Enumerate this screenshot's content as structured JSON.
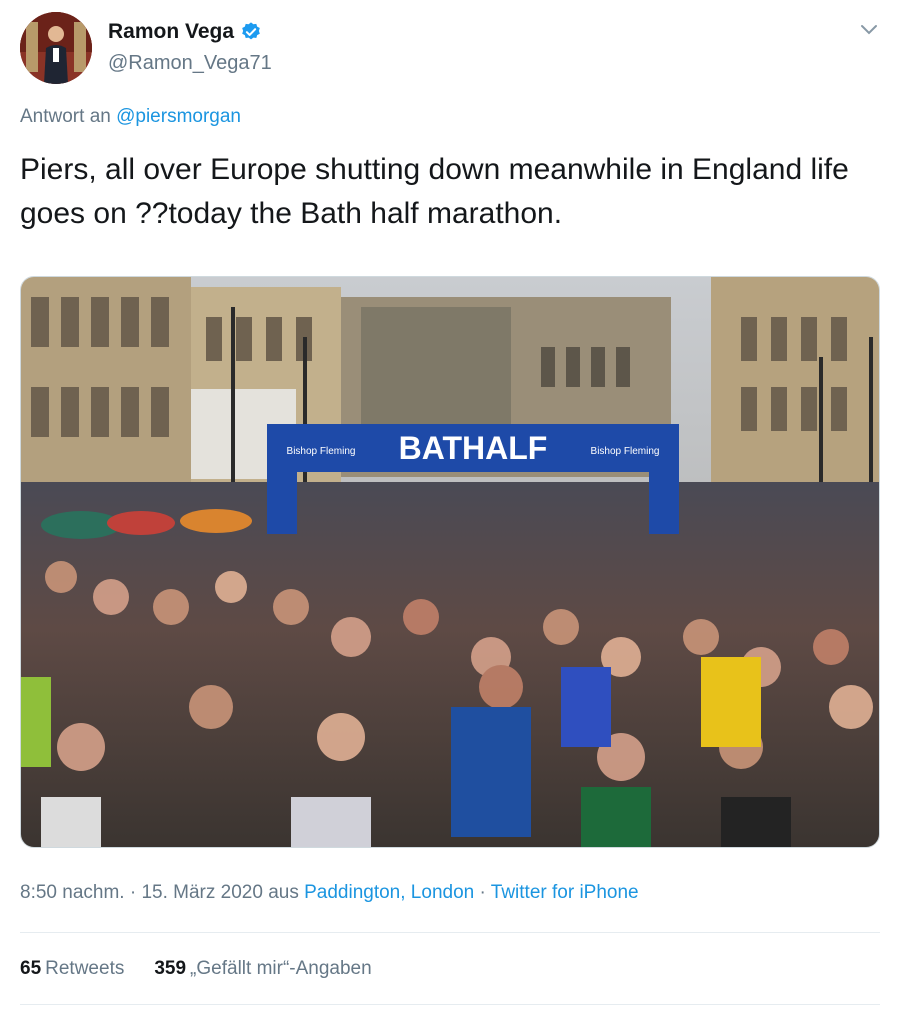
{
  "user": {
    "display_name": "Ramon Vega",
    "handle": "@Ramon_Vega71",
    "verified_icon": "verified-badge-icon"
  },
  "reply": {
    "prefix": "Antwort an",
    "mention": "@piersmorgan"
  },
  "tweet": {
    "text": "Piers, all over Europe shutting down meanwhile in England life goes on ??today the Bath half marathon."
  },
  "photo": {
    "banner_text": "BATHALF",
    "sponsor_left": "Bishop Fleming",
    "sponsor_right": "Bishop Fleming"
  },
  "meta": {
    "time_date": "8:50 nachm. · 15. März 2020 aus ",
    "location": "Paddington, London",
    "separator": " · ",
    "source": "Twitter for iPhone"
  },
  "stats": {
    "retweets_count": "65",
    "retweets_label": "Retweets",
    "likes_count": "359",
    "likes_label": "„Gefällt mir“-Angaben"
  },
  "colors": {
    "link": "#1b95e0",
    "secondary_text": "#657786",
    "banner_blue": "#1e4aa8"
  }
}
